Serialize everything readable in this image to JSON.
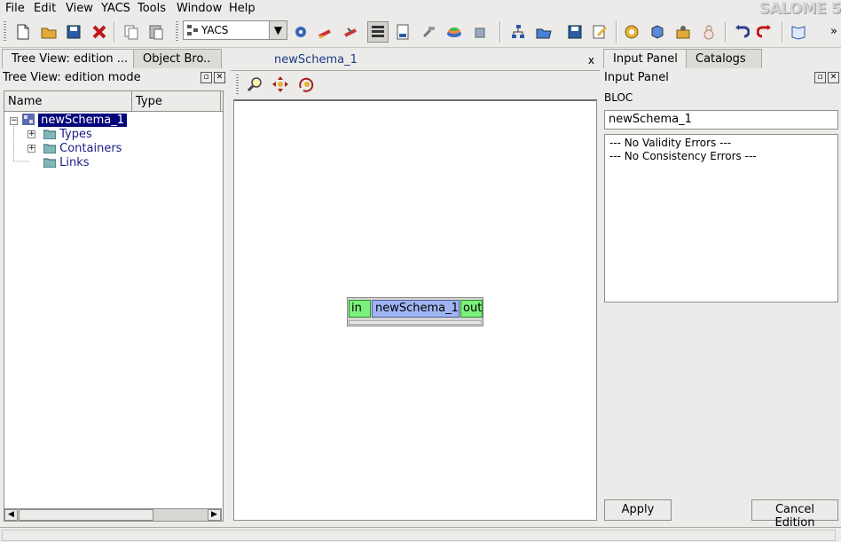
{
  "app": {
    "brand": "SALOME 5"
  },
  "menu": [
    "File",
    "Edit",
    "View",
    "YACS",
    "Tools",
    "Window",
    "Help"
  ],
  "toolbar": {
    "module_combo": "YACS",
    "icons": [
      "new-document-icon",
      "open-folder-icon",
      "save-icon",
      "close-x-icon",
      "copy-icon",
      "paste-icon",
      "yacs-module-icon",
      "gear-blue-icon",
      "pencil-red-icon",
      "pencil-red-icon",
      "schema-tree-icon",
      "new-schema-icon",
      "hammer-icon",
      "cake-icon",
      "gift-icon",
      "hierarchy-icon",
      "folder-open-icon",
      "save-icon",
      "edit-note-icon",
      "settings-gear-icon",
      "import-icon",
      "export-icon",
      "snowman-icon",
      "undo-icon",
      "redo-icon",
      "book-icon"
    ]
  },
  "left_dock": {
    "tabs": [
      {
        "label": "Tree View: edition ..."
      },
      {
        "label": "Object Bro.."
      }
    ],
    "title": "Tree View: edition mode",
    "columns": [
      "Name",
      "Type"
    ],
    "tree": {
      "root": "newSchema_1",
      "children": [
        "Types",
        "Containers",
        "Links"
      ]
    }
  },
  "center": {
    "tab": "newSchema_1",
    "close": "x",
    "node": {
      "in_port": "in",
      "name": "newSchema_1",
      "out_port": "out"
    }
  },
  "right_dock": {
    "tabs": [
      {
        "label": "Input Panel"
      },
      {
        "label": "Catalogs"
      }
    ],
    "title": "Input Panel",
    "type_label": "BLOC",
    "name_value": "newSchema_1",
    "messages": [
      "--- No Validity Errors ---",
      "--- No Consistency Errors ---"
    ],
    "apply": "Apply",
    "cancel": "Cancel Edition"
  },
  "colors": {
    "selection": "#05057a",
    "port_green": "#7cef7c",
    "node_blue": "#9fb4f2"
  }
}
